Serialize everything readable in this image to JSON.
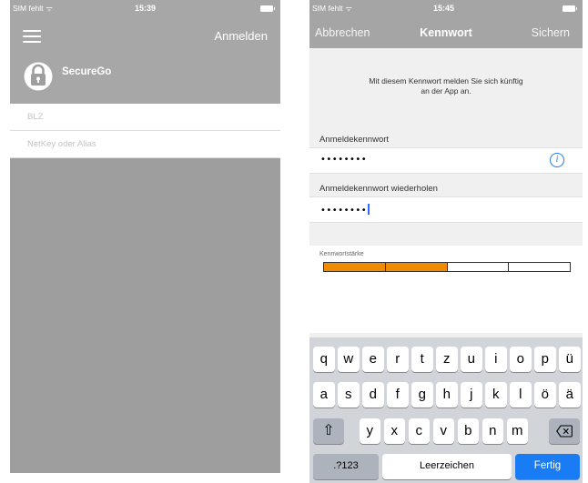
{
  "left_screen": {
    "status_bar": {
      "carrier": "SIM fehlt",
      "time": "15:39"
    },
    "nav": {
      "menu_icon": "hamburger-menu-icon",
      "signin_label": "Anmelden"
    },
    "brand": {
      "icon": "padlock-icon",
      "name": "SecureGo"
    },
    "fields": [
      {
        "placeholder": "BLZ"
      },
      {
        "placeholder": "NetKey oder Alias"
      }
    ]
  },
  "right_screen": {
    "status_bar": {
      "carrier": "SIM fehlt",
      "time": "15:45"
    },
    "nav": {
      "cancel_label": "Abbrechen",
      "title": "Kennwort",
      "save_label": "Sichern"
    },
    "info_text_line1": "Mit diesem Kennwort melden Sie sich künftig",
    "info_text_line2": "an der App an.",
    "password": {
      "label": "Anmeldekennwort",
      "value": "••••••••",
      "info_icon": "info-circle-icon"
    },
    "password_repeat": {
      "label": "Anmeldekennwort wiederholen",
      "value": "••••••••"
    },
    "strength": {
      "label": "Kennwortstärke",
      "segments_total": 4,
      "segments_filled": 2,
      "fill_color": "#ee8b00"
    },
    "keyboard": {
      "row1": [
        "q",
        "w",
        "e",
        "r",
        "t",
        "z",
        "u",
        "i",
        "o",
        "p",
        "ü"
      ],
      "row2": [
        "a",
        "s",
        "d",
        "f",
        "g",
        "h",
        "j",
        "k",
        "l",
        "ö",
        "ä"
      ],
      "row3": [
        "y",
        "x",
        "c",
        "v",
        "b",
        "n",
        "m"
      ],
      "shift_icon": "shift-arrow-icon",
      "delete_icon": "backspace-icon",
      "numbers_label": ".?123",
      "space_label": "Leerzeichen",
      "done_label": "Fertig"
    }
  },
  "colors": {
    "accent": "#1a7cf5",
    "overlay_gray": "#a7a7a7",
    "strength_orange": "#ee8b00"
  }
}
